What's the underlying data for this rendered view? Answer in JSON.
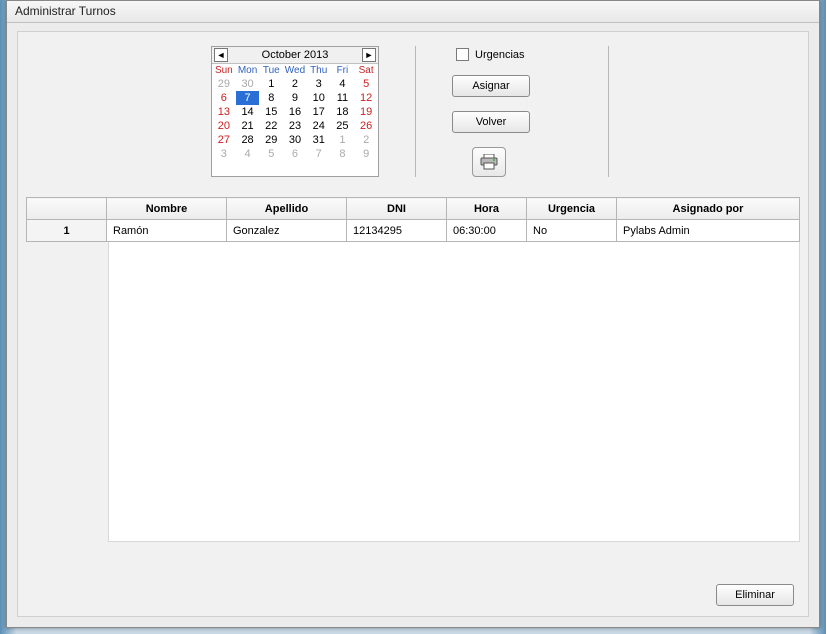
{
  "window": {
    "title": "Administrar Turnos"
  },
  "calendar": {
    "title": "October 2013",
    "dow": [
      "Sun",
      "Mon",
      "Tue",
      "Wed",
      "Thu",
      "Fri",
      "Sat"
    ],
    "weeks": [
      [
        {
          "d": 29,
          "dim": true
        },
        {
          "d": 30,
          "dim": true
        },
        {
          "d": 1
        },
        {
          "d": 2
        },
        {
          "d": 3
        },
        {
          "d": 4
        },
        {
          "d": 5,
          "red": true
        }
      ],
      [
        {
          "d": 6,
          "red": true
        },
        {
          "d": 7,
          "sel": true
        },
        {
          "d": 8
        },
        {
          "d": 9
        },
        {
          "d": 10
        },
        {
          "d": 11
        },
        {
          "d": 12,
          "red": true
        }
      ],
      [
        {
          "d": 13,
          "red": true
        },
        {
          "d": 14
        },
        {
          "d": 15
        },
        {
          "d": 16
        },
        {
          "d": 17
        },
        {
          "d": 18
        },
        {
          "d": 19,
          "red": true
        }
      ],
      [
        {
          "d": 20,
          "red": true
        },
        {
          "d": 21
        },
        {
          "d": 22
        },
        {
          "d": 23
        },
        {
          "d": 24
        },
        {
          "d": 25
        },
        {
          "d": 26,
          "red": true
        }
      ],
      [
        {
          "d": 27,
          "red": true
        },
        {
          "d": 28
        },
        {
          "d": 29
        },
        {
          "d": 30
        },
        {
          "d": 31
        },
        {
          "d": 1,
          "dim": true
        },
        {
          "d": 2,
          "dim": true
        }
      ],
      [
        {
          "d": 3,
          "dim": true
        },
        {
          "d": 4,
          "dim": true
        },
        {
          "d": 5,
          "dim": true
        },
        {
          "d": 6,
          "dim": true
        },
        {
          "d": 7,
          "dim": true
        },
        {
          "d": 8,
          "dim": true
        },
        {
          "d": 9,
          "dim": true
        }
      ]
    ]
  },
  "controls": {
    "urgencias_label": "Urgencias",
    "asignar_label": "Asignar",
    "volver_label": "Volver"
  },
  "table": {
    "headers": {
      "row": "",
      "nombre": "Nombre",
      "apellido": "Apellido",
      "dni": "DNI",
      "hora": "Hora",
      "urgencia": "Urgencia",
      "asignado": "Asignado por"
    },
    "rows": [
      {
        "n": "1",
        "nombre": "Ramón",
        "apellido": "Gonzalez",
        "dni": "12134295",
        "hora": "06:30:00",
        "urgencia": "No",
        "asignado": "Pylabs Admin"
      }
    ]
  },
  "footer": {
    "eliminar_label": "Eliminar"
  }
}
